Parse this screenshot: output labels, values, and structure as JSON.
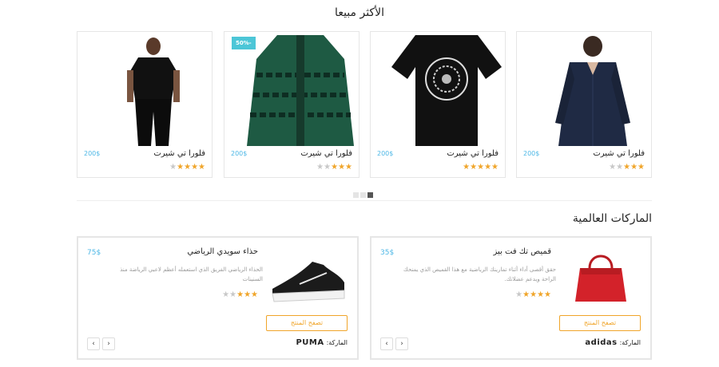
{
  "best_selling": {
    "title": "الأكثر مبيعا",
    "products": [
      {
        "name": "فلورا تي شيرت",
        "price": "200$",
        "rating": 3,
        "max_rating": 5,
        "image": "womens-navy-blouse"
      },
      {
        "name": "فلورا تي شيرت",
        "price": "200$",
        "rating": 5,
        "max_rating": 5,
        "image": "black-graphic-tshirt"
      },
      {
        "name": "فلورا تي شيرت",
        "price": "200$",
        "rating": 3,
        "max_rating": 5,
        "image": "green-puffer-jacket",
        "badge": "50%-"
      },
      {
        "name": "فلورا تي شيرت",
        "price": "200$",
        "rating": 4,
        "max_rating": 5,
        "image": "man-black-tshirt"
      }
    ],
    "pagination": {
      "count": 3,
      "active_index": 2
    }
  },
  "global_brands": {
    "title": "الماركات العالمية",
    "cards": [
      {
        "name": "قميص تك فت بيز",
        "price": "35$",
        "description": "حقق أقصى أداء أثناء تمارينك الرياضية مع هذا القميص الذي يمنحك الراحة ويدعم عضلاتك.",
        "rating": 4,
        "max_rating": 5,
        "button_label": "تصفح المنتج",
        "brand_label": "الماركة:",
        "brand_logo": "adidas",
        "image": "red-handbag",
        "prev_icon": "‹",
        "next_icon": "›"
      },
      {
        "name": "حذاء سويدي الرياضي",
        "price": "75$",
        "description": "الحذاء الرياضي الفريق الذي استعمله أعظم لاعبي الرياضة منذ السنينات",
        "rating": 3,
        "max_rating": 5,
        "button_label": "تصفح المنتج",
        "brand_label": "الماركة:",
        "brand_logo": "PUMA",
        "image": "black-sneaker",
        "prev_icon": "‹",
        "next_icon": "›"
      }
    ]
  },
  "colors": {
    "accent": "#f0a52a",
    "price": "#4db7e6",
    "badge": "#4cc6d7"
  }
}
